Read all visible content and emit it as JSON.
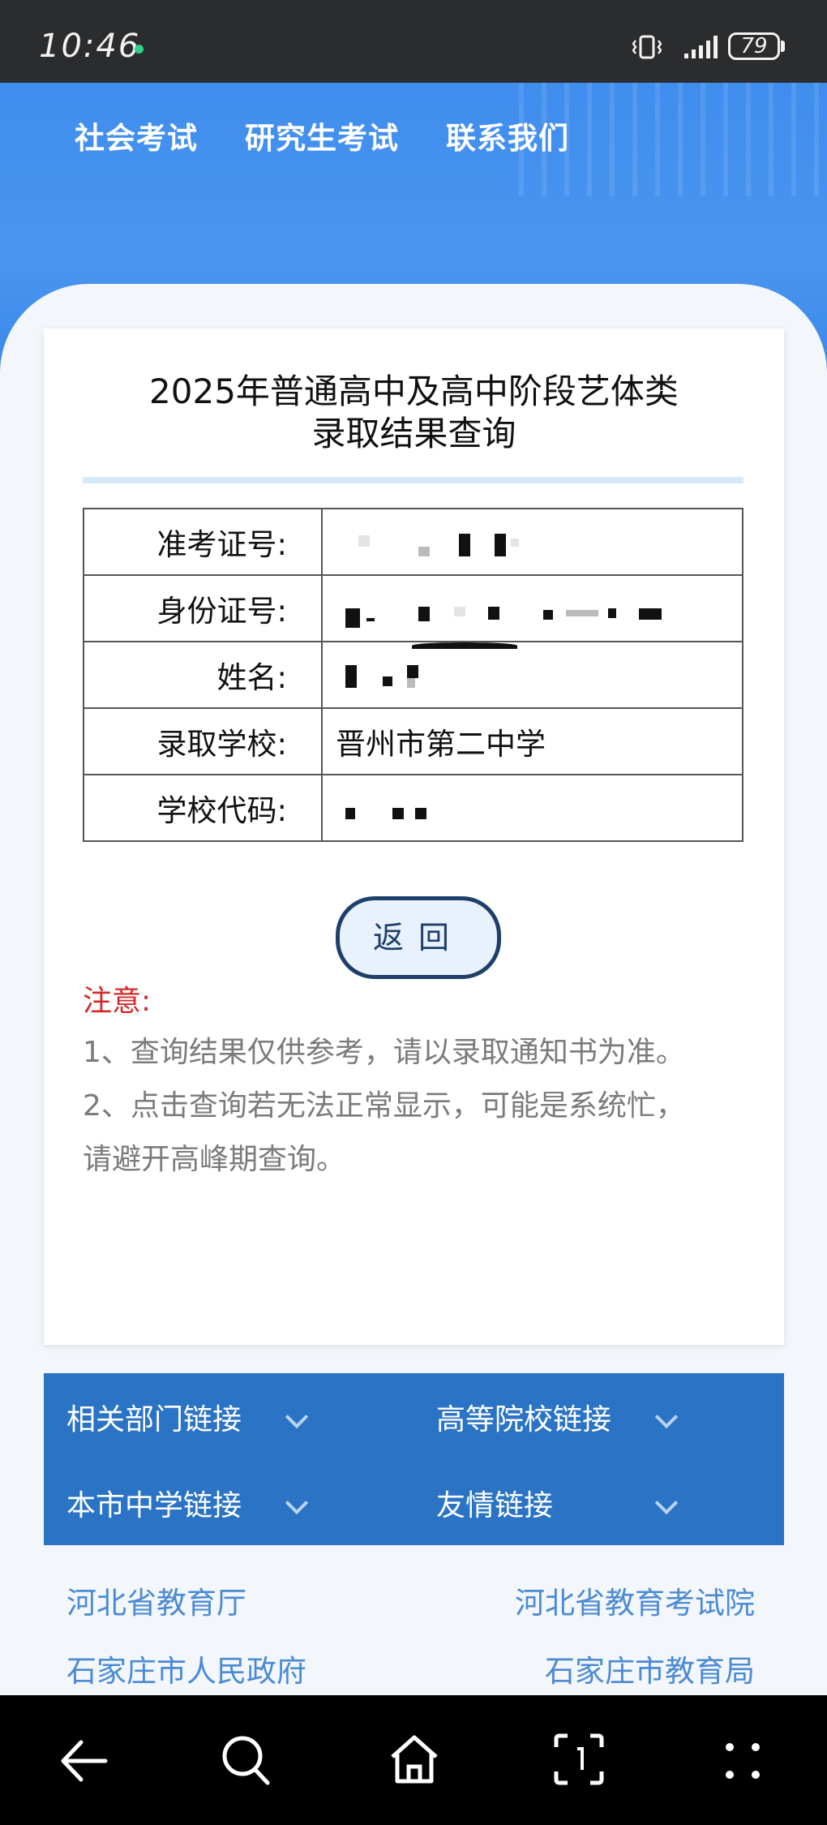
{
  "status_bar": {
    "time": "10:46",
    "battery": "79"
  },
  "nav": {
    "items": [
      "社会考试",
      "研究生考试",
      "联系我们"
    ]
  },
  "card": {
    "title_line1": "2025年普通高中及高中阶段艺体类",
    "title_line2": "录取结果查询",
    "rows": [
      {
        "label": "准考证号:",
        "value": ""
      },
      {
        "label": "身份证号:",
        "value": ""
      },
      {
        "label": "姓名:",
        "value": ""
      },
      {
        "label": "录取学校:",
        "value": "晋州市第二中学"
      },
      {
        "label": "学校代码:",
        "value": ""
      }
    ],
    "back_button": "返回",
    "notice_title": "注意:",
    "notice_lines": [
      "1、查询结果仅供参考，请以录取通知书为准。",
      "2、点击查询若无法正常显示，可能是系统忙，",
      "请避开高峰期查询。"
    ]
  },
  "links_panel": {
    "items": [
      "相关部门链接",
      "高等院校链接",
      "本市中学链接",
      "友情链接"
    ]
  },
  "footer_links": [
    "河北省教育厅",
    "河北省教育考试院",
    "石家庄市人民政府",
    "石家庄市教育局"
  ],
  "colors": {
    "header_blue": "#4a95ef",
    "panel_blue": "#2a73c5",
    "notice_red": "#d42828",
    "link_blue": "#4b8bd3"
  }
}
